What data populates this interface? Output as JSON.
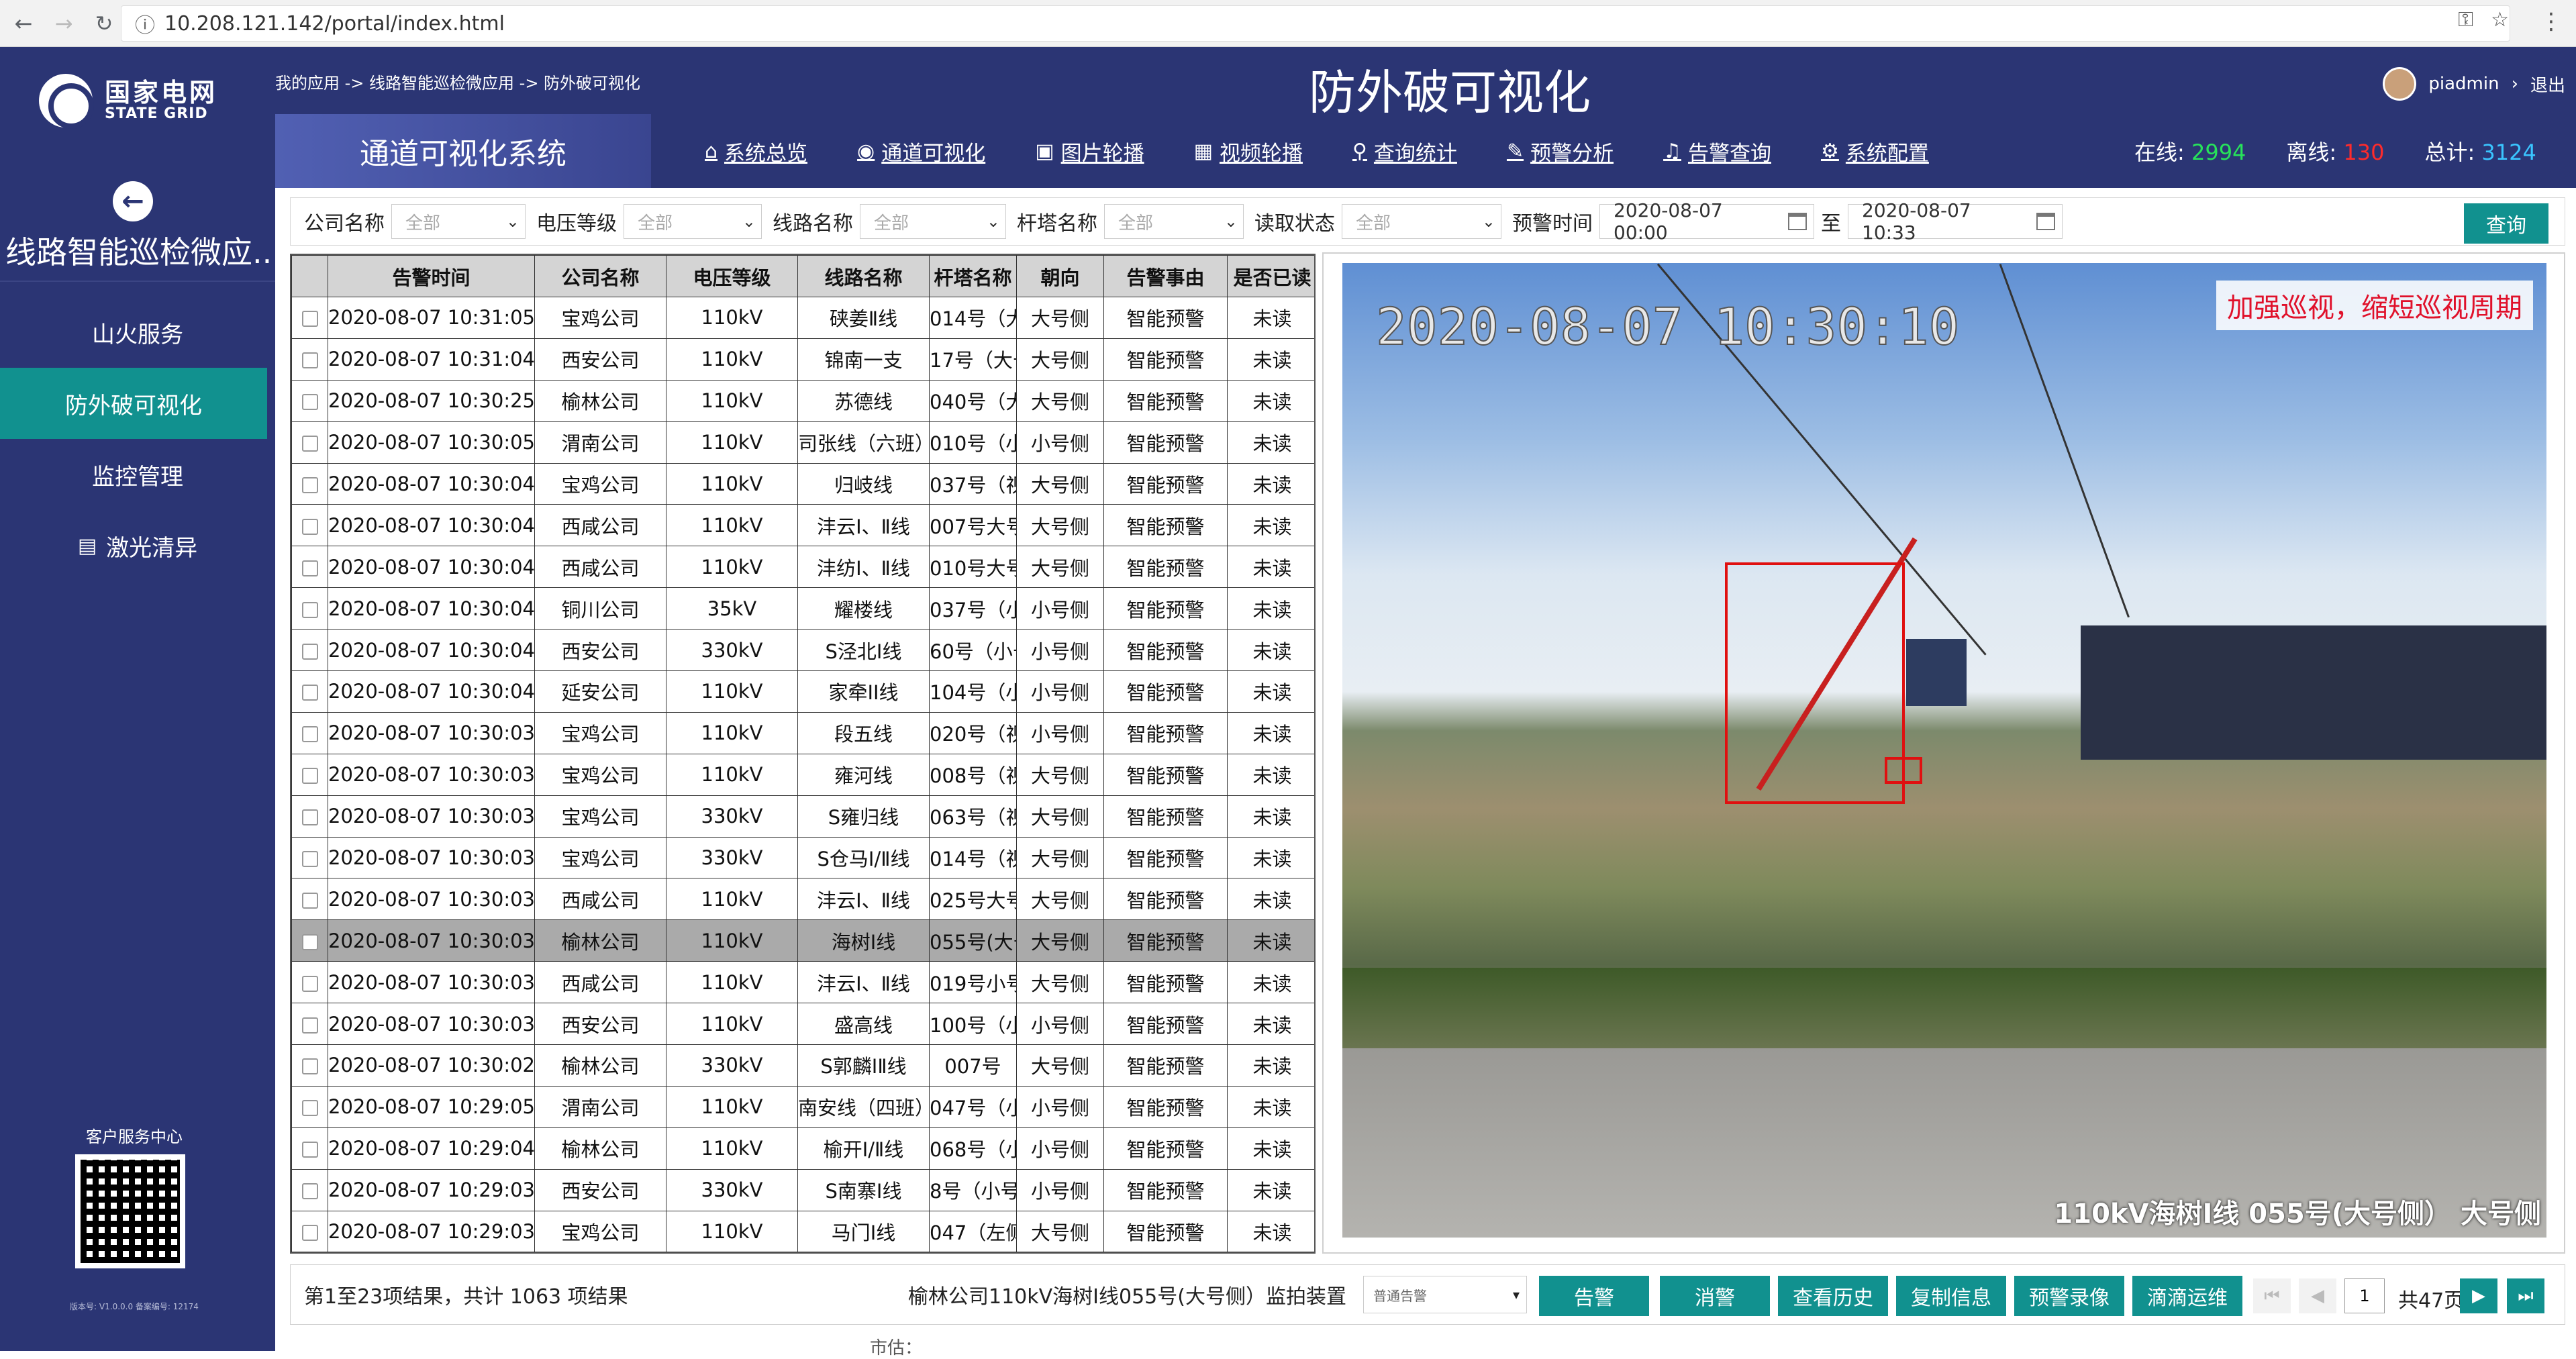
{
  "browser": {
    "url": "10.208.121.142/portal/index.html"
  },
  "logo": {
    "cn": "国家电网",
    "en": "STATE GRID"
  },
  "sidebar": {
    "app_name": "线路智能巡检微应...",
    "items": [
      {
        "label": "山火服务",
        "active": false
      },
      {
        "label": "防外破可视化",
        "active": true
      },
      {
        "label": "监控管理",
        "active": false
      },
      {
        "label": "激光清异",
        "active": false,
        "icon": "calculator-icon"
      }
    ],
    "qr_title": "客户服务中心",
    "version": "版本号: V1.0.0.0  备案编号: 12174"
  },
  "header": {
    "breadcrumb": "我的应用 -> 线路智能巡检微应用 -> 防外破可视化",
    "title": "防外破可视化",
    "user": "piadmin",
    "logout": "退出"
  },
  "subheader": {
    "system_name": "通道可视化系统",
    "nav": [
      {
        "label": "系统总览",
        "icon": "home-icon"
      },
      {
        "label": "通道可视化",
        "icon": "eye-icon"
      },
      {
        "label": "图片轮播",
        "icon": "image-icon"
      },
      {
        "label": "视频轮播",
        "icon": "video-icon"
      },
      {
        "label": "查询统计",
        "icon": "search-icon"
      },
      {
        "label": "预警分析",
        "icon": "pencil-icon"
      },
      {
        "label": "告警查询",
        "icon": "bell-icon"
      },
      {
        "label": "系统配置",
        "icon": "gear-icon"
      }
    ],
    "stats": {
      "online_label": "在线:",
      "online": "2994",
      "offline_label": "离线:",
      "offline": "130",
      "total_label": "总计:",
      "total": "3124"
    }
  },
  "filters": {
    "company_label": "公司名称",
    "company": "全部",
    "voltage_label": "电压等级",
    "voltage": "全部",
    "line_label": "线路名称",
    "line": "全部",
    "tower_label": "杆塔名称",
    "tower": "全部",
    "read_label": "读取状态",
    "read": "全部",
    "time_label": "预警时间",
    "time_from": "2020-08-07 00:00",
    "to_label": "至",
    "time_to": "2020-08-07 10:33",
    "query": "查询"
  },
  "table": {
    "headers": [
      "告警时间",
      "公司名称",
      "电压等级",
      "线路名称",
      "杆塔名称",
      "朝向",
      "告警事由",
      "是否已读"
    ],
    "rows": [
      [
        "2020-08-07 10:31:05",
        "宝鸡公司",
        "110kV",
        "硖姜Ⅱ线",
        "014号（大",
        "大号侧",
        "智能预警",
        "未读"
      ],
      [
        "2020-08-07 10:31:04",
        "西安公司",
        "110kV",
        "锦南一支",
        "17号（大号",
        "大号侧",
        "智能预警",
        "未读"
      ],
      [
        "2020-08-07 10:30:25",
        "榆林公司",
        "110kV",
        "苏德线",
        "040号（大",
        "大号侧",
        "智能预警",
        "未读"
      ],
      [
        "2020-08-07 10:30:05",
        "渭南公司",
        "110kV",
        "司张线（六班）",
        "010号（小",
        "小号侧",
        "智能预警",
        "未读"
      ],
      [
        "2020-08-07 10:30:04",
        "宝鸡公司",
        "110kV",
        "归岐线",
        "037号（视",
        "大号侧",
        "智能预警",
        "未读"
      ],
      [
        "2020-08-07 10:30:04",
        "西咸公司",
        "110kV",
        "沣云Ⅰ、Ⅱ线",
        "007号大号",
        "大号侧",
        "智能预警",
        "未读"
      ],
      [
        "2020-08-07 10:30:04",
        "西咸公司",
        "110kV",
        "沣纺Ⅰ、Ⅱ线",
        "010号大号",
        "大号侧",
        "智能预警",
        "未读"
      ],
      [
        "2020-08-07 10:30:04",
        "铜川公司",
        "35kV",
        "耀楼线",
        "037号（小",
        "小号侧",
        "智能预警",
        "未读"
      ],
      [
        "2020-08-07 10:30:04",
        "西安公司",
        "330kV",
        "S泾北Ⅰ线",
        "60号（小号",
        "小号侧",
        "智能预警",
        "未读"
      ],
      [
        "2020-08-07 10:30:04",
        "延安公司",
        "110kV",
        "家牵II线",
        "104号（小",
        "小号侧",
        "智能预警",
        "未读"
      ],
      [
        "2020-08-07 10:30:03",
        "宝鸡公司",
        "110kV",
        "段五线",
        "020号（视",
        "小号侧",
        "智能预警",
        "未读"
      ],
      [
        "2020-08-07 10:30:03",
        "宝鸡公司",
        "110kV",
        "雍河线",
        "008号（视",
        "大号侧",
        "智能预警",
        "未读"
      ],
      [
        "2020-08-07 10:30:03",
        "宝鸡公司",
        "330kV",
        "S雍归线",
        "063号（视",
        "大号侧",
        "智能预警",
        "未读"
      ],
      [
        "2020-08-07 10:30:03",
        "宝鸡公司",
        "330kV",
        "S仓马Ⅰ/Ⅱ线",
        "014号（视",
        "大号侧",
        "智能预警",
        "未读"
      ],
      [
        "2020-08-07 10:30:03",
        "西咸公司",
        "110kV",
        "沣云Ⅰ、Ⅱ线",
        "025号大号",
        "大号侧",
        "智能预警",
        "未读"
      ],
      [
        "2020-08-07 10:30:03",
        "榆林公司",
        "110kV",
        "海树Ⅰ线",
        "055号(大号",
        "大号侧",
        "智能预警",
        "未读"
      ],
      [
        "2020-08-07 10:30:03",
        "西咸公司",
        "110kV",
        "沣云Ⅰ、Ⅱ线",
        "019号小号",
        "大号侧",
        "智能预警",
        "未读"
      ],
      [
        "2020-08-07 10:30:03",
        "西安公司",
        "110kV",
        "盛高线",
        "100号（小",
        "小号侧",
        "智能预警",
        "未读"
      ],
      [
        "2020-08-07 10:30:02",
        "榆林公司",
        "330kV",
        "S郭麟ⅠⅡ线",
        "007号",
        "大号侧",
        "智能预警",
        "未读"
      ],
      [
        "2020-08-07 10:29:05",
        "渭南公司",
        "110kV",
        "南安线（四班）",
        "047号（小",
        "小号侧",
        "智能预警",
        "未读"
      ],
      [
        "2020-08-07 10:29:04",
        "榆林公司",
        "110kV",
        "榆开Ⅰ/Ⅱ线",
        "068号（小",
        "小号侧",
        "智能预警",
        "未读"
      ],
      [
        "2020-08-07 10:29:03",
        "西安公司",
        "330kV",
        "S南寨Ⅰ线",
        "8号（小号",
        "小号侧",
        "智能预警",
        "未读"
      ],
      [
        "2020-08-07 10:29:03",
        "宝鸡公司",
        "110kV",
        "马门Ⅰ线",
        "047（左侧",
        "大号侧",
        "智能预警",
        "未读"
      ]
    ],
    "selected_index": 15
  },
  "image": {
    "timestamp": "2020-08-07 10:30:10",
    "banner": "加强巡视，缩短巡视周期",
    "caption": "110kV海树Ⅰ线 055号(大号侧） 大号侧"
  },
  "footer": {
    "pager_info": "第1至23项结果，共计 1063 项结果",
    "device": "榆林公司110kV海树Ⅰ线055号(大号侧）监拍装置",
    "level": "普通告警",
    "buttons": [
      "告警",
      "消警",
      "查看历史",
      "复制信息",
      "预警录像",
      "滴滴运维"
    ],
    "page": "1",
    "total_pages": "共47页",
    "stray_text": "市估："
  },
  "colors": {
    "primary": "#2b3574",
    "accent": "#11918f",
    "online": "#27e35a",
    "offline": "#ff2b2b",
    "total": "#3ac5ff"
  }
}
